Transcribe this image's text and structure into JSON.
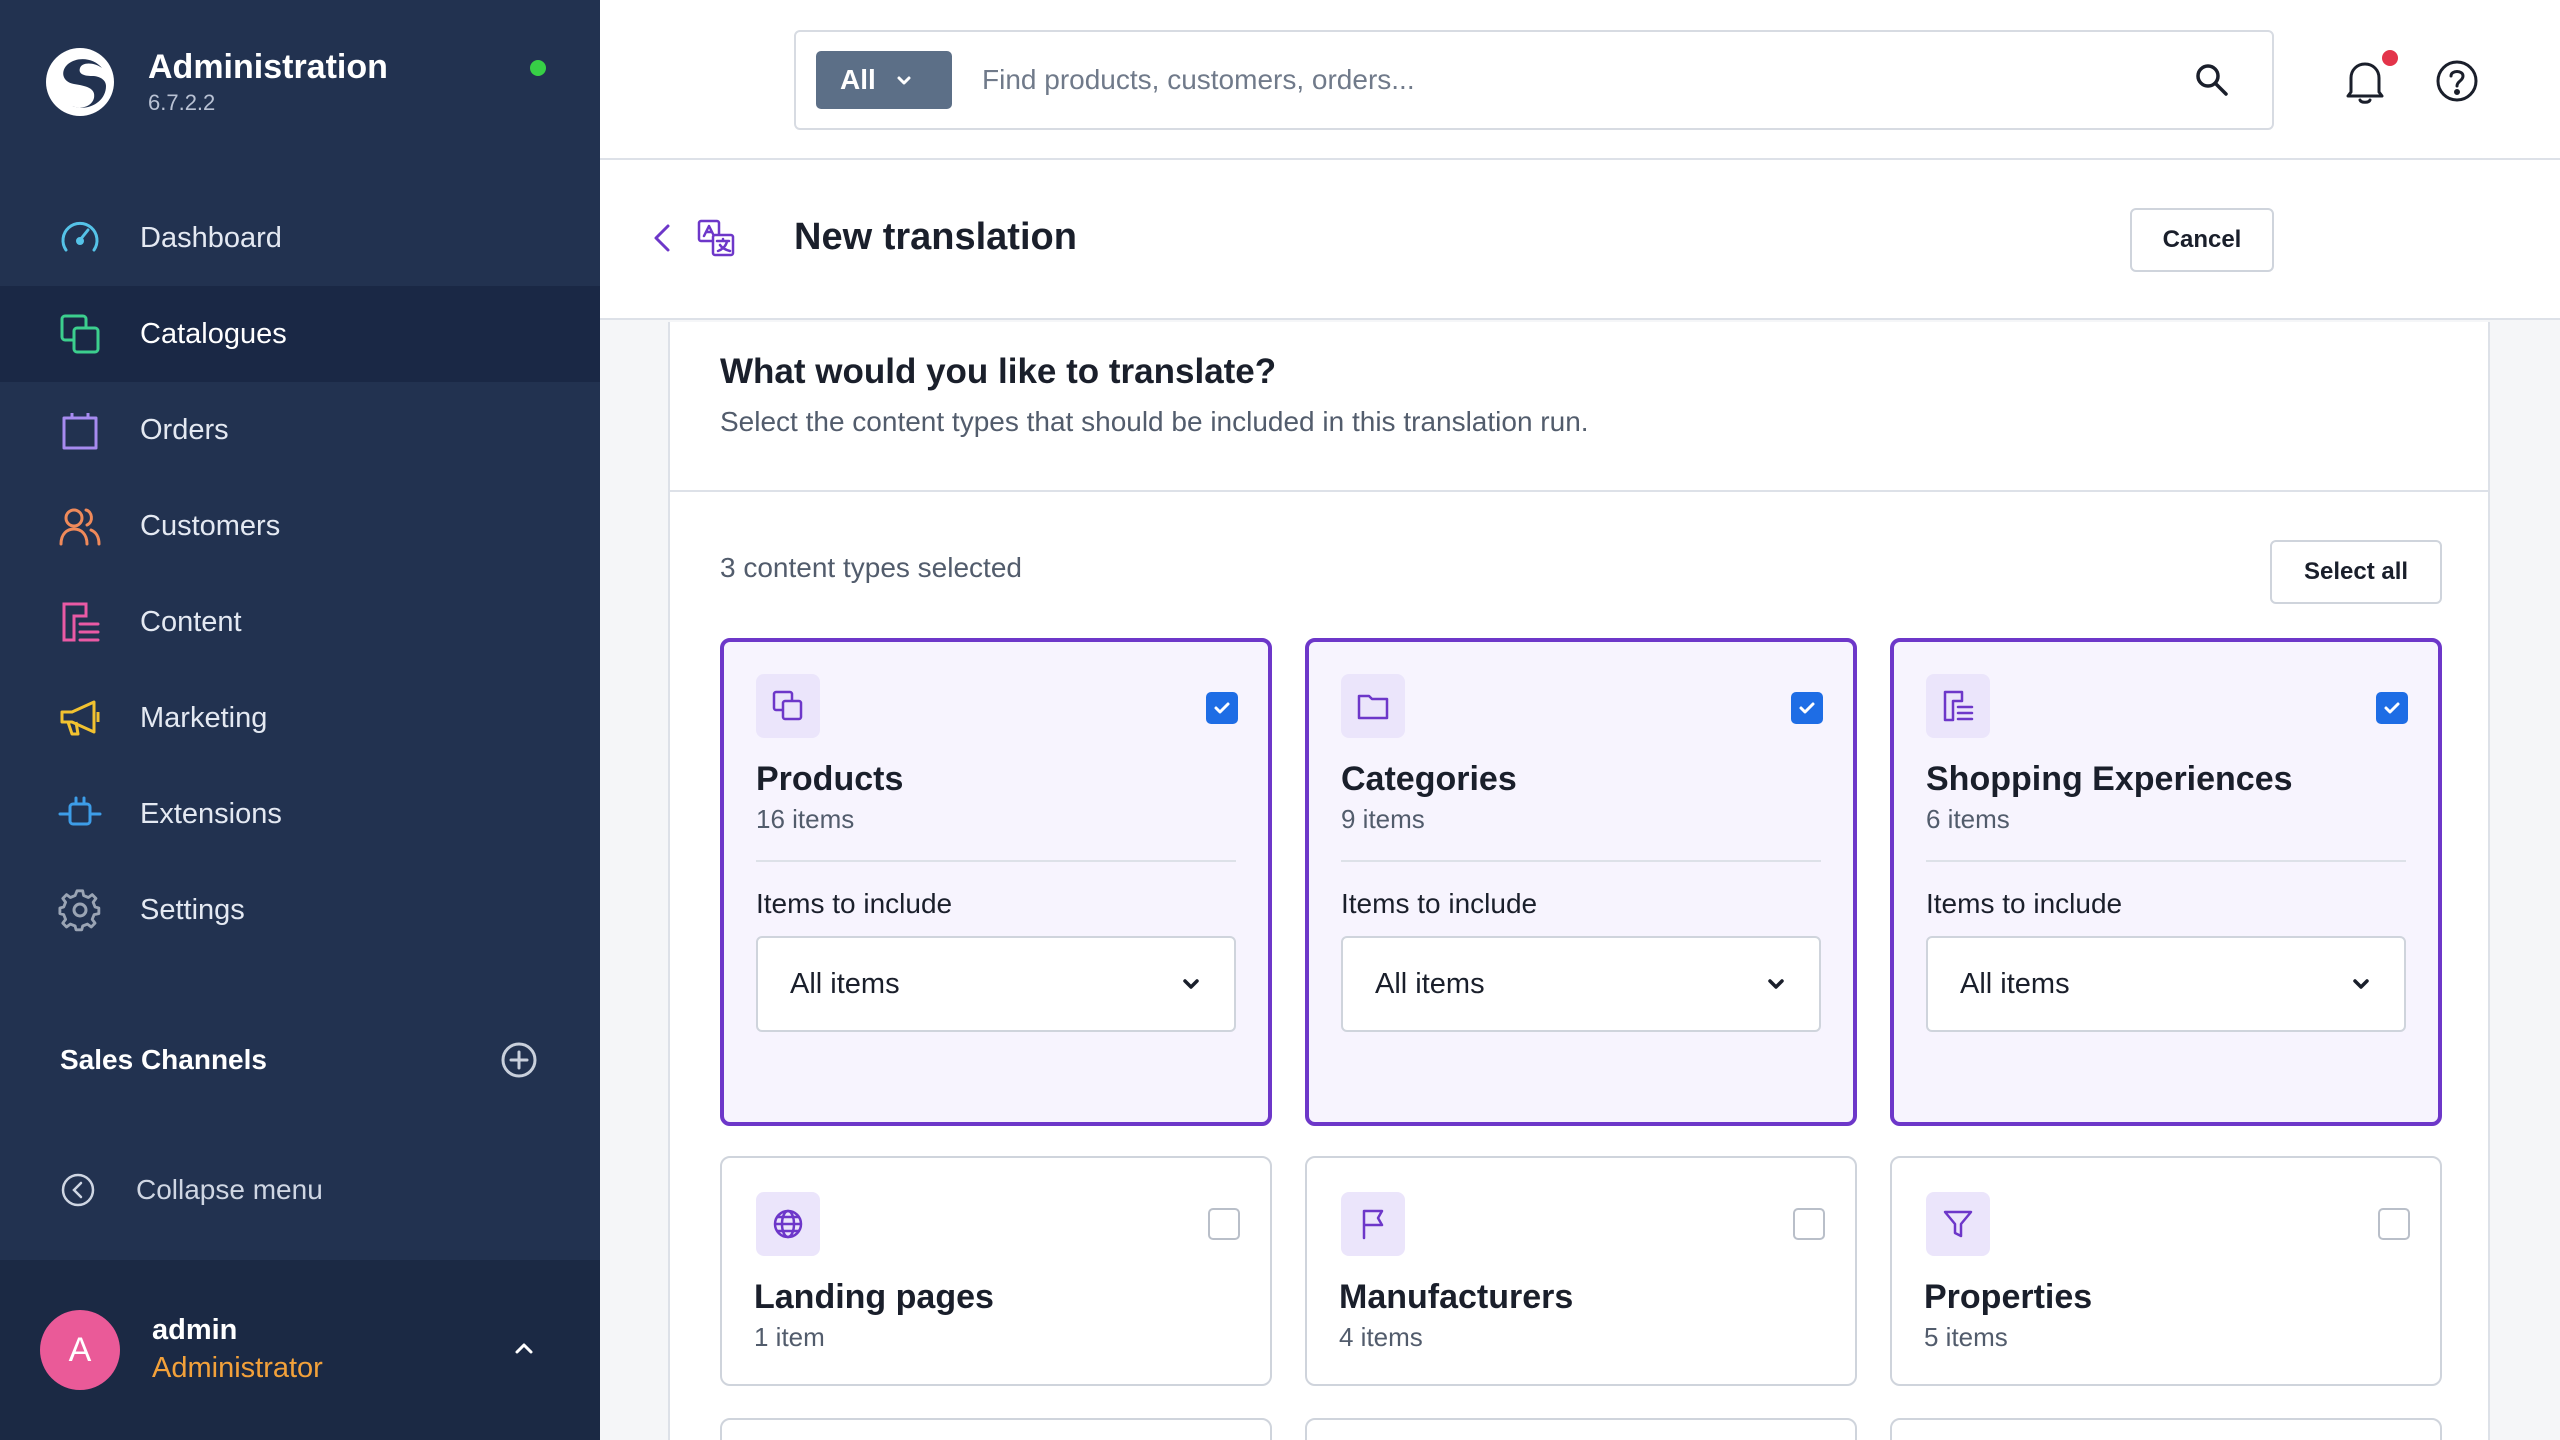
{
  "app": {
    "name": "Administration",
    "version": "6.7.2.2",
    "status_color": "#37d046"
  },
  "nav": {
    "items": [
      {
        "label": "Dashboard",
        "icon": "dashboard-gauge-icon",
        "color": "#55c3e8"
      },
      {
        "label": "Catalogues",
        "icon": "catalogues-icon",
        "color": "#3ccf8e",
        "active": true
      },
      {
        "label": "Orders",
        "icon": "shopping-bag-icon",
        "color": "#a78bf0"
      },
      {
        "label": "Customers",
        "icon": "users-icon",
        "color": "#f08a5a"
      },
      {
        "label": "Content",
        "icon": "content-icon",
        "color": "#ea5aa5"
      },
      {
        "label": "Marketing",
        "icon": "megaphone-icon",
        "color": "#f2c230"
      },
      {
        "label": "Extensions",
        "icon": "plug-icon",
        "color": "#3d9de8"
      },
      {
        "label": "Settings",
        "icon": "gear-icon",
        "color": "#9aa4b4"
      }
    ],
    "sales_channels_title": "Sales Channels",
    "collapse_label": "Collapse menu"
  },
  "user": {
    "initial": "A",
    "name": "admin",
    "role": "Administrator"
  },
  "search": {
    "scope": "All",
    "placeholder": "Find products, customers, orders..."
  },
  "header": {
    "title": "New translation",
    "cancel_label": "Cancel"
  },
  "main": {
    "title": "What would you like to translate?",
    "subtitle": "Select the content types that should be included in this translation run.",
    "selected_count": "3 content types selected",
    "select_all_label": "Select all",
    "include_label": "Items to include",
    "tiles": [
      {
        "name": "Products",
        "count": "16 items",
        "icon": "products-icon",
        "selected": true,
        "include": "All items"
      },
      {
        "name": "Categories",
        "count": "9 items",
        "icon": "folder-icon",
        "selected": true,
        "include": "All items"
      },
      {
        "name": "Shopping Experiences",
        "count": "6 items",
        "icon": "layout-icon",
        "selected": true,
        "include": "All items"
      },
      {
        "name": "Landing pages",
        "count": "1 item",
        "icon": "globe-icon",
        "selected": false
      },
      {
        "name": "Manufacturers",
        "count": "4 items",
        "icon": "flag-icon",
        "selected": false
      },
      {
        "name": "Properties",
        "count": "5 items",
        "icon": "filter-icon",
        "selected": false
      }
    ]
  },
  "colors": {
    "sidebar_bg": "#223250",
    "accent_purple": "#6d37c9",
    "checkbox_blue": "#1e6de5",
    "role_orange": "#f3a13a",
    "avatar_pink": "#ea5a98",
    "notification_red": "#e3344a"
  }
}
